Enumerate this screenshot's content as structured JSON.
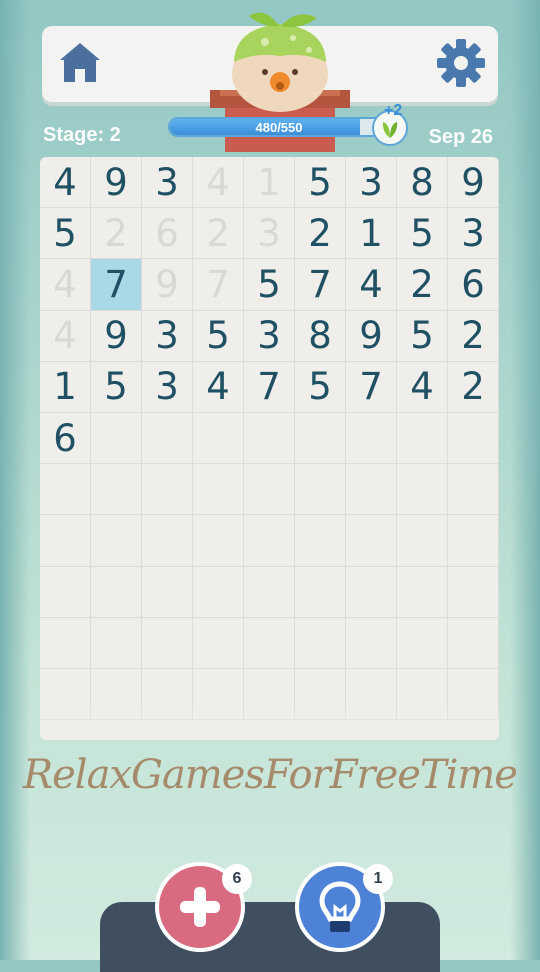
{
  "header": {
    "home_icon": "home-icon",
    "settings_icon": "gear-icon",
    "mascot": "sprout-mascot-in-pot"
  },
  "stage": {
    "label": "Stage: 2"
  },
  "progress": {
    "text": "480/550",
    "current": 480,
    "max": 550,
    "fraction": 0.873,
    "bonus_text": "+2",
    "reward_icon": "leaf-icon"
  },
  "date": {
    "label": "Sep 26"
  },
  "board": {
    "columns": 9,
    "visible_rows": 11,
    "cells": [
      [
        {
          "v": "4"
        },
        {
          "v": "9"
        },
        {
          "v": "3"
        },
        {
          "v": "4",
          "faded": true
        },
        {
          "v": "1",
          "faded": true
        },
        {
          "v": "5"
        },
        {
          "v": "3"
        },
        {
          "v": "8"
        },
        {
          "v": "9"
        }
      ],
      [
        {
          "v": "5"
        },
        {
          "v": "2",
          "faded": true
        },
        {
          "v": "6",
          "faded": true
        },
        {
          "v": "2",
          "faded": true
        },
        {
          "v": "3",
          "faded": true
        },
        {
          "v": "2"
        },
        {
          "v": "1"
        },
        {
          "v": "5"
        },
        {
          "v": "3"
        }
      ],
      [
        {
          "v": "4",
          "faded": true
        },
        {
          "v": "7",
          "selected": true
        },
        {
          "v": "9",
          "faded": true
        },
        {
          "v": "7",
          "faded": true
        },
        {
          "v": "5"
        },
        {
          "v": "7"
        },
        {
          "v": "4"
        },
        {
          "v": "2"
        },
        {
          "v": "6"
        }
      ],
      [
        {
          "v": "4",
          "faded": true
        },
        {
          "v": "9"
        },
        {
          "v": "3"
        },
        {
          "v": "5"
        },
        {
          "v": "3"
        },
        {
          "v": "8"
        },
        {
          "v": "9"
        },
        {
          "v": "5"
        },
        {
          "v": "2"
        }
      ],
      [
        {
          "v": "1"
        },
        {
          "v": "5"
        },
        {
          "v": "3"
        },
        {
          "v": "4"
        },
        {
          "v": "7"
        },
        {
          "v": "5"
        },
        {
          "v": "7"
        },
        {
          "v": "4"
        },
        {
          "v": "2"
        }
      ],
      [
        {
          "v": "6"
        }
      ]
    ]
  },
  "watermark": "RelaxGamesForFreeTime",
  "actions": {
    "add": {
      "icon": "plus-icon",
      "count": "6"
    },
    "hint": {
      "icon": "lightbulb-icon",
      "count": "1"
    }
  },
  "colors": {
    "digit": "#1f5063",
    "faded_digit": "#d9d9d4",
    "selected_cell": "#a9d8e6",
    "add_button": "#d96b80",
    "hint_button": "#4d82d6",
    "progress_fill": "#3a8fd8"
  }
}
